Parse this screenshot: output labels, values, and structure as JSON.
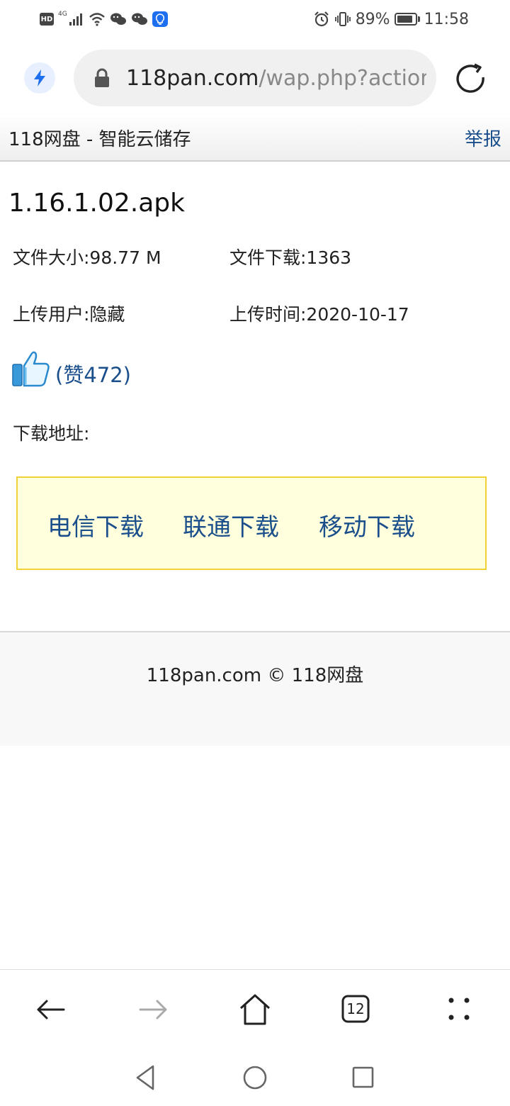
{
  "status_bar": {
    "hd_badge": "HD",
    "network_label": "4G",
    "battery_percent": "89%",
    "battery_level": 0.89,
    "time": "11:58",
    "icons": [
      "hd-icon",
      "signal-icon",
      "wifi-icon",
      "wechat-icon",
      "wechat-icon",
      "lightbulb-icon",
      "alarm-icon",
      "vibrate-icon",
      "battery-icon"
    ]
  },
  "browser": {
    "url_host": "118pan.com",
    "url_path": "/wap.php?action=",
    "icons": [
      "bolt-icon",
      "lock-icon",
      "reload-icon"
    ]
  },
  "site_header": {
    "title": "118网盘 - 智能云储存",
    "report_label": "举报"
  },
  "file": {
    "name": "1.16.1.02.apk",
    "size": "文件大小:98.77 M",
    "downloads": "文件下载:1363",
    "uploader": "上传用户:隐藏",
    "upload_time": "上传时间:2020-10-17",
    "likes": "(赞472)",
    "download_address_label": "下载地址:"
  },
  "download_links": [
    "电信下载",
    "联通下载",
    "移动下载"
  ],
  "footer": {
    "text": "118pan.com © 118网盘"
  },
  "toolbar": {
    "tabs_count": "12",
    "icons": [
      "back-arrow-icon",
      "forward-arrow-icon",
      "home-icon",
      "tabs-icon",
      "menu-dots-icon"
    ]
  },
  "system_nav": {
    "icons": [
      "nav-back-icon",
      "nav-home-icon",
      "nav-recents-icon"
    ]
  },
  "colors": {
    "link": "#1a4f8c",
    "download_box_bg": "#ffffdd",
    "download_box_border": "#f0d238",
    "accent": "#1e6ff0"
  }
}
